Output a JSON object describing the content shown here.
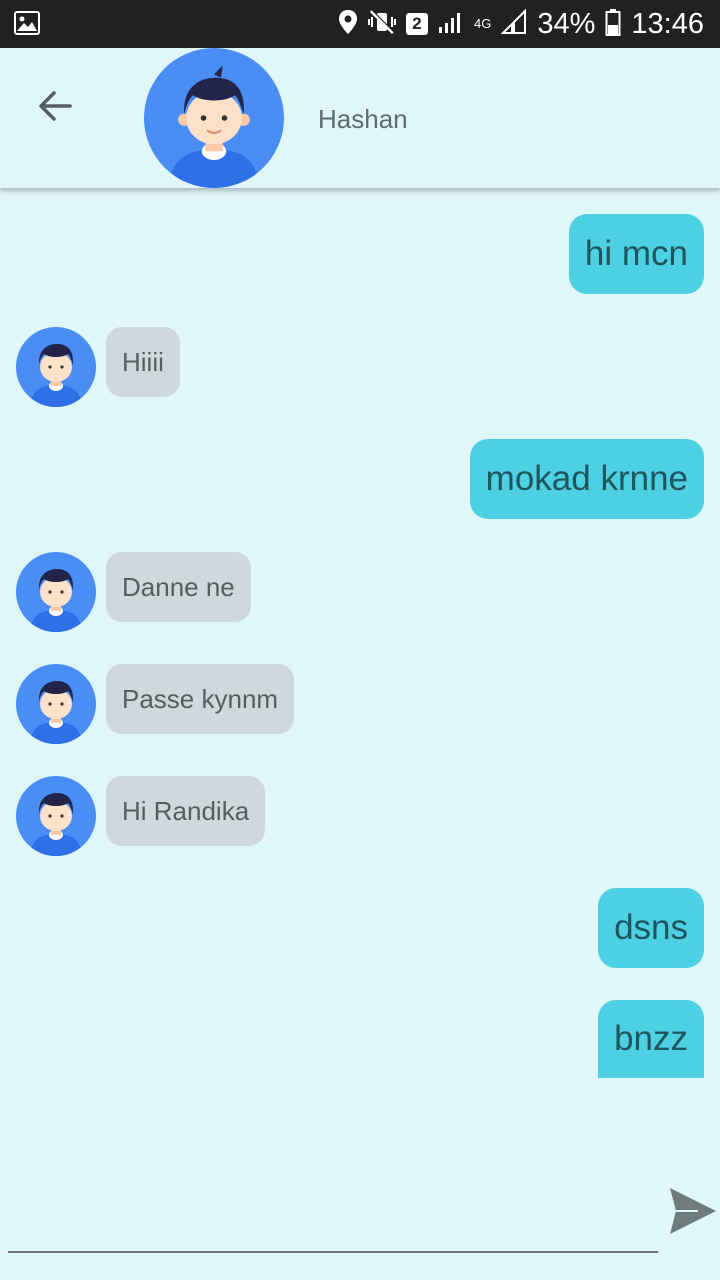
{
  "status_bar": {
    "battery": "34%",
    "time": "13:46",
    "sim_badge": "2",
    "network": "4G"
  },
  "header": {
    "contact_name": "Hashan",
    "back_icon": "arrow-left-icon",
    "avatar_icon": "user-avatar-icon"
  },
  "messages": [
    {
      "direction": "outgoing",
      "text": "hi mcn"
    },
    {
      "direction": "incoming",
      "text": "Hiiii"
    },
    {
      "direction": "outgoing",
      "text": "mokad krnne"
    },
    {
      "direction": "incoming",
      "text": "Danne ne"
    },
    {
      "direction": "incoming",
      "text": "Passe kynnm"
    },
    {
      "direction": "incoming",
      "text": "Hi Randika"
    },
    {
      "direction": "outgoing",
      "text": "dsns"
    },
    {
      "direction": "outgoing",
      "text": "bnzz"
    }
  ],
  "composer": {
    "value": "",
    "placeholder": "",
    "send_icon": "send-icon"
  },
  "colors": {
    "background": "#e0f7fa",
    "outgoing_bubble": "#4dd0e1",
    "incoming_bubble": "#cfd8dc",
    "avatar_blue": "#4a8ef5"
  }
}
